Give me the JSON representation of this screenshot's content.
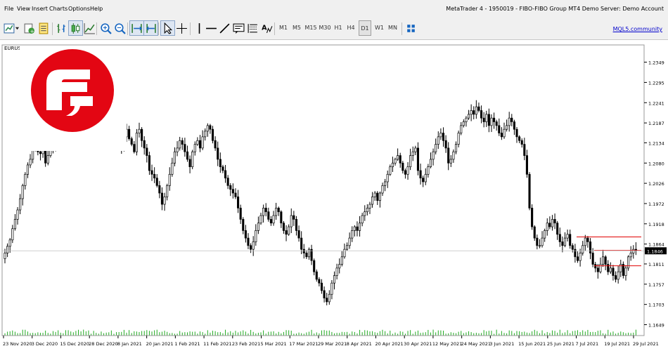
{
  "menu": [
    "File",
    "View",
    "Insert",
    "Charts",
    "Options",
    "Help"
  ],
  "window_title": "MetaTrader 4 - 1950019 - FIBO-FIBO Group MT4 Demo Server: Demo Account",
  "toolbar": {
    "timeframes": [
      "M1",
      "M5",
      "M15",
      "M30",
      "H1",
      "H4",
      "D1",
      "W1",
      "MN"
    ],
    "active_timeframe": "D1",
    "link_text": "MQL5.community",
    "icons": [
      "new-chart-icon",
      "dropdown-arrow-icon",
      "profiles-icon",
      "market-watch-icon",
      "data-window-icon",
      "bar-chart-icon",
      "candlestick-chart-icon",
      "line-chart-icon",
      "zoom-in-icon",
      "zoom-out-icon",
      "autoscroll-icon",
      "chart-shift-icon",
      "cursor-icon",
      "crosshair-icon",
      "vertical-line-icon",
      "horizontal-line-icon",
      "trendline-icon",
      "text-icon",
      "fibonacci-icon",
      "objects-icon",
      "periods-grid-icon"
    ]
  },
  "chart": {
    "symbol": "EURUSD",
    "current_price": "1.1846",
    "price_scale": [
      "1.2349",
      "1.2295",
      "1.2241",
      "1.2187",
      "1.2134",
      "1.2080",
      "1.2026",
      "1.1972",
      "1.1918",
      "1.1864",
      "1.1811",
      "1.1757",
      "1.1703",
      "1.1649"
    ],
    "date_labels": [
      "23 Nov 2020",
      "3 Dec 2020",
      "15 Dec 2020",
      "28 Dec 2020",
      "8 Jan 2021",
      "20 Jan 2021",
      "1 Feb 2021",
      "11 Feb 2021",
      "23 Feb 2021",
      "5 Mar 2021",
      "17 Mar 2021",
      "29 Mar 2021",
      "8 Apr 2021",
      "20 Apr 2021",
      "30 Apr 2021",
      "12 May 2021",
      "24 May 2021",
      "3 Jun 2021",
      "15 Jun 2021",
      "25 Jun 2021",
      "7 Jul 2021",
      "19 Jul 2021",
      "29 Jul 2021"
    ],
    "colors": {
      "bull": "#ffffff",
      "bear": "#000000",
      "level_line": "#e00000",
      "logo": "#e30613",
      "volume": "#22aa22"
    }
  },
  "chart_data": {
    "type": "candlestick",
    "symbol": "EURUSD",
    "timeframe": "D1",
    "ylim": [
      1.162,
      1.2395
    ],
    "current_price": 1.1846,
    "levels": [
      {
        "price": 1.1883,
        "from": "7 Jul 2021",
        "to": "end"
      },
      {
        "price": 1.1847,
        "from": "13 Jul 2021",
        "to": "end"
      },
      {
        "price": 1.1806,
        "from": "13 Jul 2021",
        "to": "end"
      }
    ],
    "close_series": [
      1.184,
      1.1858,
      1.1875,
      1.1905,
      1.193,
      1.1955,
      1.1985,
      1.202,
      1.205,
      1.2075,
      1.209,
      1.212,
      1.214,
      1.211,
      1.2105,
      1.2125,
      1.208,
      1.21,
      1.213,
      1.212,
      1.214,
      1.215,
      1.2135,
      1.216,
      1.2165,
      1.2175,
      1.219,
      1.216,
      1.215,
      1.2185,
      1.22,
      1.221,
      1.2225,
      1.22,
      1.218,
      1.2215,
      1.224,
      1.2245,
      1.223,
      1.22,
      1.2195,
      1.223,
      1.221,
      1.2175,
      1.216,
      1.213,
      1.212,
      1.215,
      1.217,
      1.2145,
      1.213,
      1.211,
      1.216,
      1.217,
      1.214,
      1.212,
      1.21,
      1.206,
      1.205,
      1.204,
      1.202,
      1.2,
      1.197,
      1.199,
      1.202,
      1.205,
      1.208,
      1.211,
      1.212,
      1.214,
      1.213,
      1.211,
      1.209,
      1.207,
      1.211,
      1.213,
      1.214,
      1.212,
      1.215,
      1.2165,
      1.218,
      1.217,
      1.214,
      1.212,
      1.209,
      1.207,
      1.206,
      1.204,
      1.202,
      1.201,
      1.2,
      1.199,
      1.196,
      1.193,
      1.19,
      1.188,
      1.186,
      1.185,
      1.187,
      1.19,
      1.192,
      1.194,
      1.196,
      1.195,
      1.193,
      1.192,
      1.194,
      1.196,
      1.195,
      1.192,
      1.19,
      1.189,
      1.191,
      1.194,
      1.193,
      1.19,
      1.188,
      1.185,
      1.184,
      1.183,
      1.185,
      1.182,
      1.179,
      1.177,
      1.176,
      1.174,
      1.172,
      1.171,
      1.173,
      1.176,
      1.178,
      1.18,
      1.181,
      1.183,
      1.185,
      1.186,
      1.188,
      1.19,
      1.191,
      1.19,
      1.192,
      1.194,
      1.195,
      1.196,
      1.197,
      1.199,
      1.2,
      1.198,
      1.2,
      1.202,
      1.203,
      1.205,
      1.207,
      1.208,
      1.209,
      1.21,
      1.208,
      1.206,
      1.205,
      1.207,
      1.21,
      1.211,
      1.212,
      1.206,
      1.204,
      1.203,
      1.205,
      1.207,
      1.209,
      1.211,
      1.213,
      1.215,
      1.216,
      1.214,
      1.212,
      1.208,
      1.209,
      1.211,
      1.213,
      1.216,
      1.218,
      1.219,
      1.22,
      1.221,
      1.222,
      1.221,
      1.223,
      1.222,
      1.22,
      1.219,
      1.221,
      1.218,
      1.22,
      1.219,
      1.218,
      1.216,
      1.215,
      1.217,
      1.218,
      1.22,
      1.219,
      1.217,
      1.215,
      1.214,
      1.213,
      1.21,
      1.205,
      1.196,
      1.191,
      1.188,
      1.186,
      1.186,
      1.188,
      1.19,
      1.192,
      1.191,
      1.193,
      1.192,
      1.189,
      1.187,
      1.186,
      1.188,
      1.189,
      1.186,
      1.185,
      1.183,
      1.182,
      1.184,
      1.186,
      1.188,
      1.187,
      1.184,
      1.181,
      1.18,
      1.179,
      1.181,
      1.183,
      1.181,
      1.179,
      1.18,
      1.178,
      1.177,
      1.179,
      1.181,
      1.178,
      1.18,
      1.183,
      1.184,
      1.185,
      1.1846
    ]
  }
}
